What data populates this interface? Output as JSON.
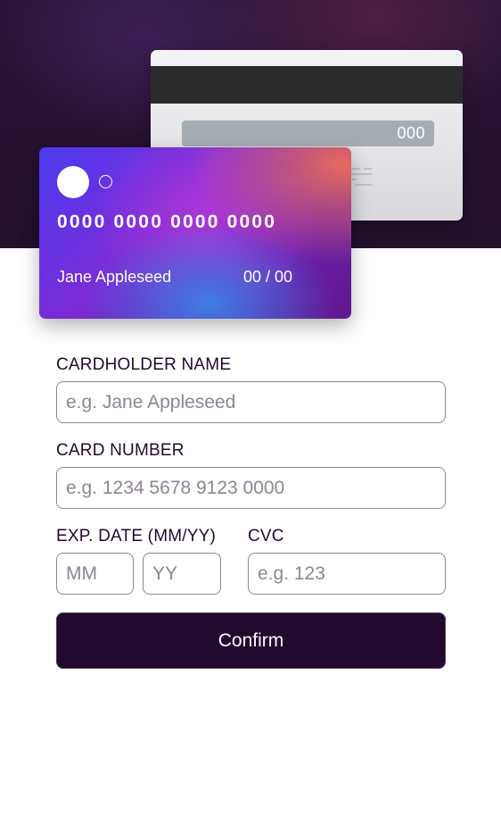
{
  "card_back": {
    "cvc": "000"
  },
  "card_front": {
    "number": "0000 0000 0000 0000",
    "name": "Jane Appleseed",
    "expiry": "00 / 00"
  },
  "form": {
    "cardholder_label": "CARDHOLDER NAME",
    "cardholder_placeholder": "e.g. Jane Appleseed",
    "number_label": "CARD NUMBER",
    "number_placeholder": "e.g. 1234 5678 9123 0000",
    "exp_label": "EXP. DATE (MM/YY)",
    "month_placeholder": "MM",
    "year_placeholder": "YY",
    "cvc_label": "CVC",
    "cvc_placeholder": "e.g. 123",
    "confirm_label": "Confirm"
  },
  "colors": {
    "dark_violet": "#21092f",
    "hero_background": "#21102c",
    "input_border": "#8e8593"
  }
}
